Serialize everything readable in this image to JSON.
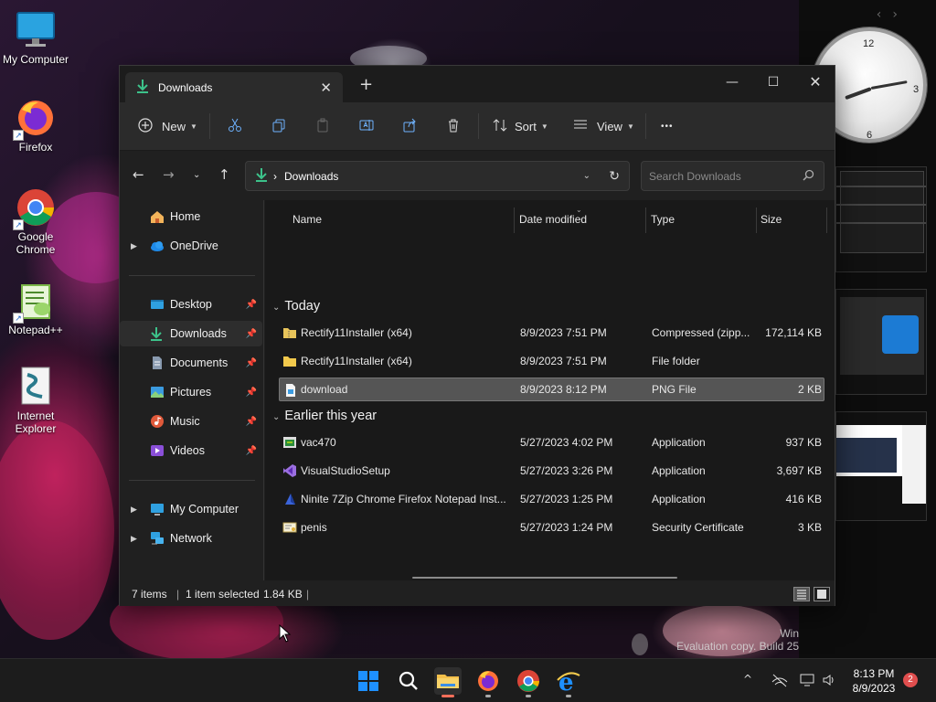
{
  "desktop": {
    "icons": [
      {
        "label": "My Computer",
        "icon": "monitor-icon"
      },
      {
        "label": "Firefox",
        "icon": "firefox-icon"
      },
      {
        "label": "Google Chrome",
        "icon": "chrome-icon"
      },
      {
        "label": "Notepad++",
        "icon": "notepadpp-icon"
      },
      {
        "label": "Internet Explorer",
        "icon": "ie-icon"
      }
    ],
    "watermark": {
      "line1": "Win",
      "line2": "Evaluation copy. Build 25"
    },
    "side_clock": {
      "n12": "12",
      "n3": "3",
      "n6": "6"
    },
    "side_nav": {
      "prev": "‹",
      "next": "›"
    }
  },
  "window": {
    "tab_title": "Downloads",
    "tab_close": "✕",
    "new_tab": "+",
    "controls": {
      "minimize": "—",
      "maximize": "☐",
      "close": "✕"
    },
    "toolbar": {
      "new_label": "New",
      "sort_label": "Sort",
      "view_label": "View",
      "more": "•••"
    },
    "address": {
      "separator": "›",
      "path": "Downloads",
      "search_placeholder": "Search Downloads"
    },
    "sidebar": {
      "home": "Home",
      "onedrive": "OneDrive",
      "desktop": "Desktop",
      "downloads": "Downloads",
      "documents": "Documents",
      "pictures": "Pictures",
      "music": "Music",
      "videos": "Videos",
      "my_computer": "My Computer",
      "network": "Network"
    },
    "columns": {
      "name": "Name",
      "date": "Date modified",
      "type": "Type",
      "size": "Size"
    },
    "groups": {
      "today": "Today",
      "earlier": "Earlier this year"
    },
    "files": [
      {
        "name": "Rectify11Installer (x64)",
        "date": "8/9/2023 7:51 PM",
        "type": "Compressed (zipp...",
        "size": "172,114 KB",
        "icon": "zip-folder-icon"
      },
      {
        "name": "Rectify11Installer (x64)",
        "date": "8/9/2023 7:51 PM",
        "type": "File folder",
        "size": "",
        "icon": "folder-icon"
      },
      {
        "name": "download",
        "date": "8/9/2023 8:12 PM",
        "type": "PNG File",
        "size": "2 KB",
        "icon": "png-file-icon"
      },
      {
        "name": "vac470",
        "date": "5/27/2023 4:02 PM",
        "type": "Application",
        "size": "937 KB",
        "icon": "app-icon"
      },
      {
        "name": "VisualStudioSetup",
        "date": "5/27/2023 3:26 PM",
        "type": "Application",
        "size": "3,697 KB",
        "icon": "visual-studio-icon"
      },
      {
        "name": "Ninite 7Zip Chrome Firefox Notepad Inst...",
        "date": "5/27/2023 1:25 PM",
        "type": "Application",
        "size": "416 KB",
        "icon": "ninite-icon"
      },
      {
        "name": "penis",
        "date": "5/27/2023 1:24 PM",
        "type": "Security Certificate",
        "size": "3 KB",
        "icon": "certificate-icon"
      }
    ],
    "status": {
      "items": "7 items",
      "selected": "1 item selected",
      "size": "1.84 KB"
    }
  },
  "taskbar": {
    "time": "8:13 PM",
    "date": "8/9/2023",
    "notifications": "2",
    "tray_chevron": "^"
  }
}
